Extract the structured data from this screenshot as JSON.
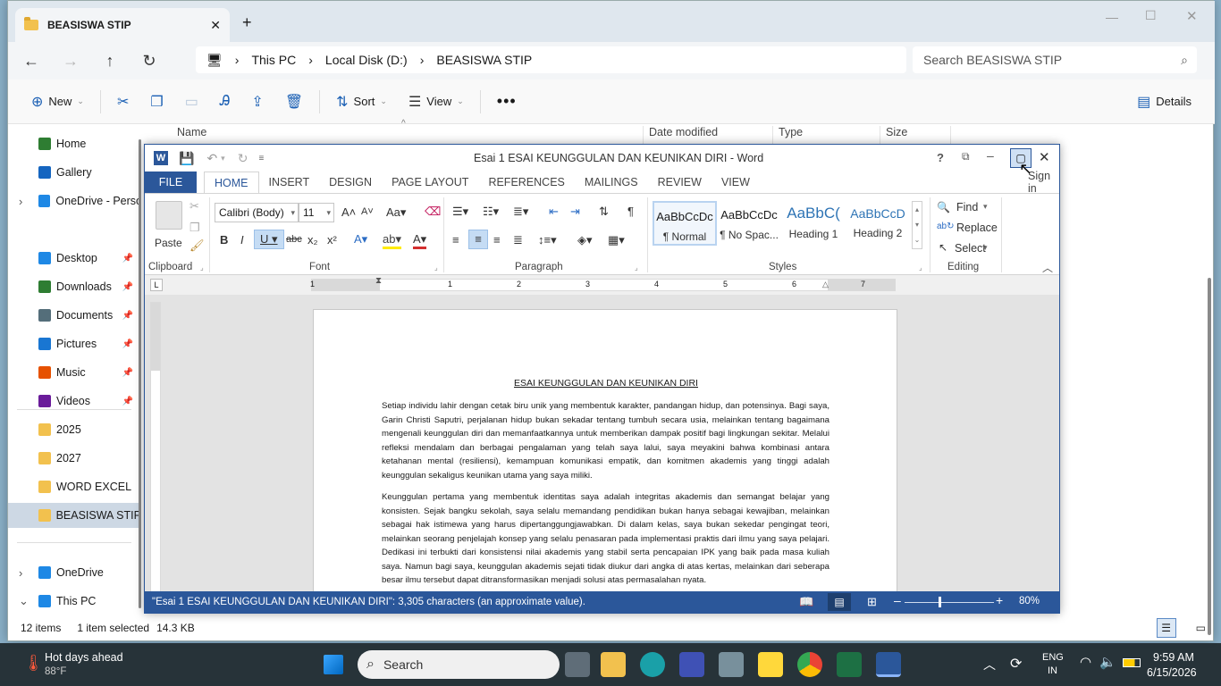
{
  "explorer": {
    "tab_title": "BEASISWA STIP",
    "breadcrumb": [
      "This PC",
      "Local Disk (D:)",
      "BEASISWA STIP"
    ],
    "search_placeholder": "Search BEASISWA STIP",
    "cmd": {
      "new": "New",
      "sort": "Sort",
      "view": "View",
      "details": "Details"
    },
    "columns": [
      "Name",
      "Date modified",
      "Type",
      "Size"
    ],
    "nav": [
      {
        "label": "Home",
        "icon": "home-icon",
        "color": "#2e7d32"
      },
      {
        "label": "Gallery",
        "icon": "gallery-icon",
        "color": "#1565c0"
      },
      {
        "label": "OneDrive - Perso",
        "icon": "cloud-icon",
        "color": "#1e88e5"
      },
      {
        "label": "Desktop",
        "icon": "desktop-icon",
        "color": "#1e88e5"
      },
      {
        "label": "Downloads",
        "icon": "download-icon",
        "color": "#2e7d32"
      },
      {
        "label": "Documents",
        "icon": "documents-icon",
        "color": "#546e7a"
      },
      {
        "label": "Pictures",
        "icon": "pictures-icon",
        "color": "#1976d2"
      },
      {
        "label": "Music",
        "icon": "music-icon",
        "color": "#e65100"
      },
      {
        "label": "Videos",
        "icon": "videos-icon",
        "color": "#6a1b9a"
      },
      {
        "label": "2025",
        "icon": "folder-icon",
        "color": "#f2c14e"
      },
      {
        "label": "2027",
        "icon": "folder-icon",
        "color": "#f2c14e"
      },
      {
        "label": "WORD EXCEL",
        "icon": "folder-icon",
        "color": "#f2c14e"
      },
      {
        "label": "BEASISWA STIP",
        "icon": "folder-icon",
        "color": "#f2c14e"
      },
      {
        "label": "OneDrive",
        "icon": "cloud-icon",
        "color": "#1e88e5"
      },
      {
        "label": "This PC",
        "icon": "pc-icon",
        "color": "#1e88e5"
      }
    ],
    "status": {
      "items": "12 items",
      "selected": "1 item selected",
      "size": "14.3 KB"
    }
  },
  "word": {
    "title": "Esai 1 ESAI KEUNGGULAN DAN KEUNIKAN DIRI - Word",
    "sign_in": "Sign in",
    "tabs": [
      "FILE",
      "HOME",
      "INSERT",
      "DESIGN",
      "PAGE LAYOUT",
      "REFERENCES",
      "MAILINGS",
      "REVIEW",
      "VIEW"
    ],
    "active_tab": "HOME",
    "font_name": "Calibri (Body)",
    "font_size": "11",
    "paste": "Paste",
    "groups": {
      "clipboard": "Clipboard",
      "font": "Font",
      "paragraph": "Paragraph",
      "styles": "Styles",
      "editing": "Editing"
    },
    "styles": [
      {
        "sample": "AaBbCcDc",
        "name": "¶ Normal"
      },
      {
        "sample": "AaBbCcDc",
        "name": "¶ No Spac..."
      },
      {
        "sample": "AaBbC(",
        "name": "Heading 1"
      },
      {
        "sample": "AaBbCcD",
        "name": "Heading 2"
      }
    ],
    "editing": {
      "find": "Find",
      "replace": "Replace",
      "select": "Select"
    },
    "ruler_numbers": [
      "1",
      "1",
      "2",
      "3",
      "4",
      "5",
      "6",
      "7"
    ],
    "doc": {
      "title": "ESAI KEUNGGULAN DAN KEUNIKAN DIRI",
      "p1": "Setiap individu lahir dengan cetak biru unik yang membentuk karakter, pandangan hidup, dan potensinya. Bagi saya, Garin Christi Saputri, perjalanan hidup bukan sekadar tentang tumbuh secara usia, melainkan tentang bagaimana mengenali keunggulan diri dan memanfaatkannya untuk memberikan dampak positif bagi lingkungan sekitar. Melalui refleksi mendalam dan berbagai pengalaman yang telah saya lalui, saya meyakini bahwa kombinasi antara ketahanan mental (resiliensi), kemampuan komunikasi empatik, dan komitmen akademis yang tinggi adalah keunggulan sekaligus keunikan utama yang saya miliki.",
      "p2": "Keunggulan pertama yang membentuk identitas saya adalah integritas akademis dan semangat belajar yang konsisten. Sejak bangku sekolah, saya selalu memandang pendidikan bukan hanya sebagai kewajiban, melainkan sebagai hak istimewa yang harus dipertanggungjawabkan. Di dalam kelas, saya bukan sekedar pengingat teori, melainkan seorang penjelajah konsep yang selalu penasaran pada implementasi praktis dari ilmu yang saya pelajari. Dedikasi ini terbukti dari konsistensi nilai akademis yang stabil serta pencapaian IPK yang baik pada masa kuliah saya. Namun bagi saya, keunggulan akademis sejati tidak diukur dari angka di atas kertas, melainkan dari seberapa besar ilmu tersebut dapat ditransformasikan menjadi solusi atas permasalahan nyata."
    },
    "status_text": "\"Esai 1 ESAI KEUNGGULAN DAN KEUNIKAN DIRI\": 3,305 characters (an approximate value).",
    "zoom": "80%",
    "zoom_fraction": 0.8
  },
  "taskbar": {
    "weather_title": "Hot days ahead",
    "weather_temp": "88°F",
    "search": "Search",
    "lang1": "ENG",
    "lang2": "IN",
    "time": "9:59 AM",
    "date": "6/15/2026"
  }
}
